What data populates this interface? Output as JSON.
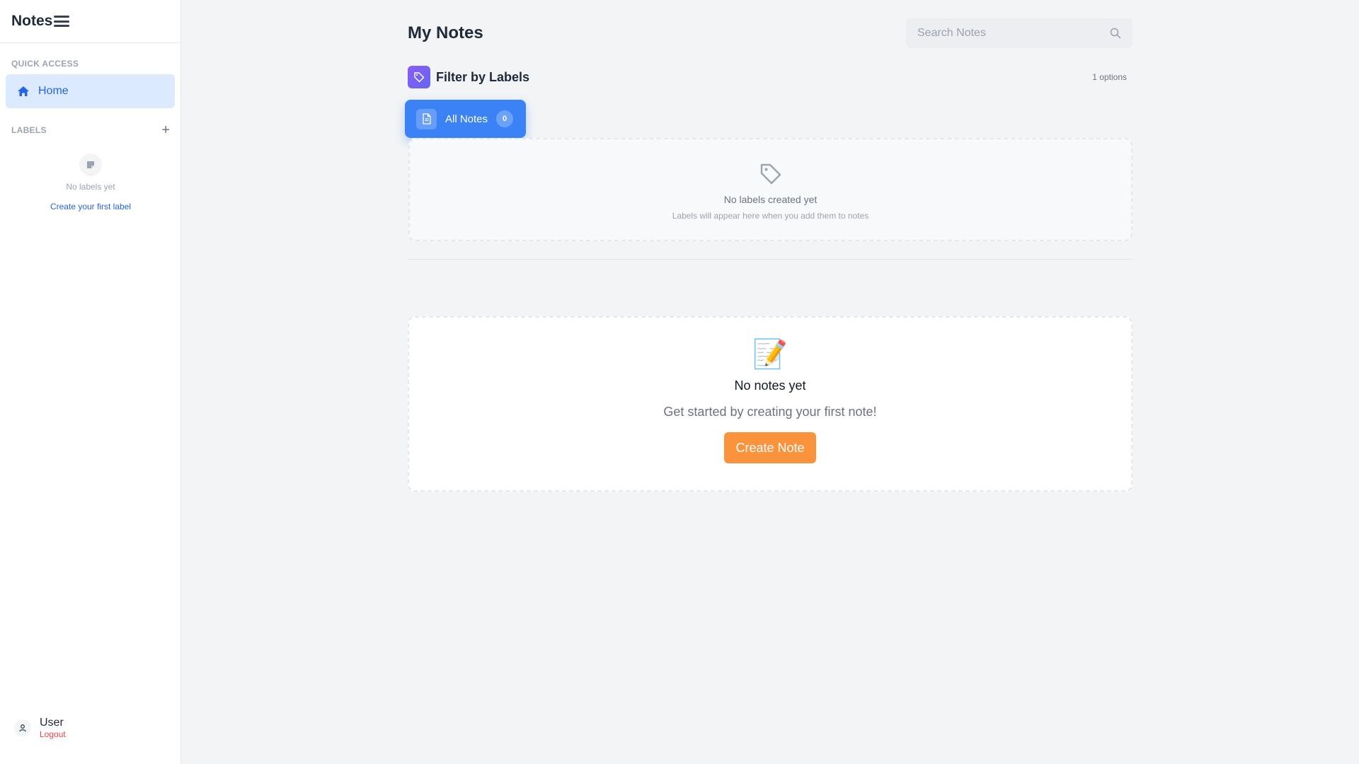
{
  "sidebar": {
    "brand": "Notes",
    "quick_access_title": "QUICK ACCESS",
    "home_label": "Home",
    "labels_title": "LABELS",
    "no_labels": "No labels yet",
    "create_first_label": "Create your first label",
    "user": {
      "name": "User",
      "logout": "Logout"
    }
  },
  "main": {
    "title": "My Notes",
    "search": {
      "placeholder": "Search Notes",
      "value": ""
    },
    "filter": {
      "title": "Filter by Labels",
      "options_count": "1 options",
      "all_notes_label": "All Notes",
      "all_notes_count": "0"
    },
    "labels_empty": {
      "title": "No labels created yet",
      "subtitle": "Labels will appear here when you add them to notes"
    },
    "notes_empty": {
      "emoji": "📝",
      "title": "No notes yet",
      "subtitle": "Get started by creating your first note!",
      "button": "Create Note"
    }
  },
  "colors": {
    "accent_blue": "#3b82f6",
    "active_bg": "#dbeafe",
    "create_orange": "#fb923c",
    "logout_red": "#ef4444",
    "tag_badge_gradient": [
      "#8b5cf6",
      "#6366f1"
    ]
  },
  "icons": [
    "menu-icon",
    "home-icon",
    "plus-icon",
    "note-icon",
    "user-icon",
    "search-icon",
    "tag-icon",
    "document-icon",
    "memo-icon"
  ]
}
